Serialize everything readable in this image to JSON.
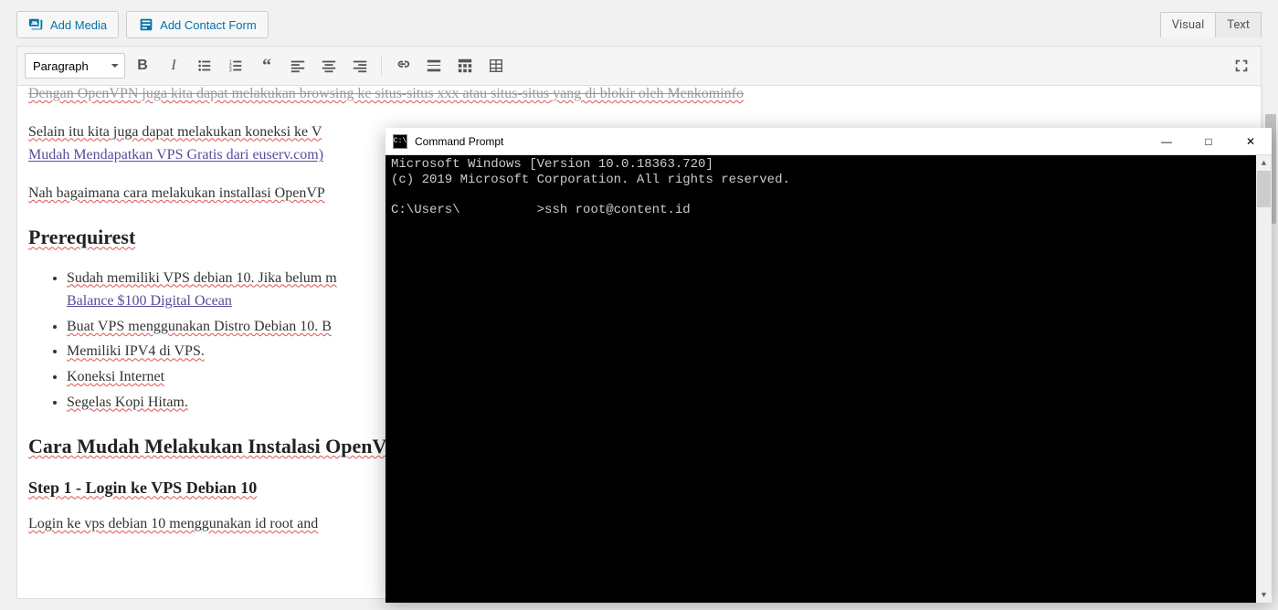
{
  "buttons": {
    "add_media": "Add Media",
    "add_contact_form": "Add Contact Form"
  },
  "tabs": {
    "visual": "Visual",
    "text": "Text"
  },
  "toolbar": {
    "format_selected": "Paragraph"
  },
  "content": {
    "partial_top": "Dengan OpenVPN juga kita dapat melakukan browsing ke situs-situs xxx atau situs-situs yang di blokir oleh Menkominfo",
    "p1a": "Selain itu kita juga dapat melakukan koneksi ke V",
    "p1b": "Mudah Mendapatkan VPS Gratis dari euserv.com)",
    "p2": "Nah bagaimana cara melakukan installasi OpenVP",
    "h2a": "Prerequirest",
    "li1a": "Sudah memiliki VPS debian 10. Jika belum m",
    "li1b": "Balance $100 Digital Ocean",
    "li2": "Buat VPS menggunakan Distro Debian 10. B",
    "li3": "Memiliki IPV4 di VPS.",
    "li4": "Koneksi Internet",
    "li5": "Segelas Kopi Hitam.",
    "h2b": "Cara Mudah Melakukan Instalasi OpenV",
    "h3a": "Step 1 - Login ke VPS Debian 10",
    "p3": "Login ke vps debian 10 menggunakan id root and"
  },
  "cmd": {
    "title": "Command Prompt",
    "line1": "Microsoft Windows [Version 10.0.18363.720]",
    "line2": "(c) 2019 Microsoft Corporation. All rights reserved.",
    "prompt_user": "C:\\Users\\",
    "prompt_cmd": ">ssh root@content.id"
  }
}
